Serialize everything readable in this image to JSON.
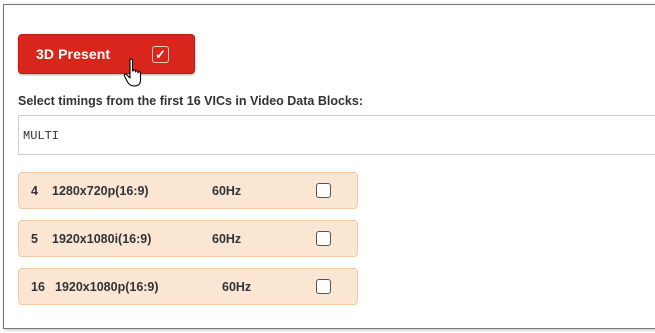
{
  "panel": {
    "present_button": {
      "label": "3D Present",
      "checked": true,
      "check_glyph": "✓",
      "color": "#d9261c"
    },
    "instruction": "Select timings from the first 16 VICs in Video Data Blocks:",
    "multi_field": {
      "value": "MULTI"
    },
    "vics": [
      {
        "vic": "4",
        "resolution": "1280x720p(16:9)",
        "rate": "60Hz",
        "checked": false
      },
      {
        "vic": "5",
        "resolution": "1920x1080i(16:9)",
        "rate": "60Hz",
        "checked": false
      },
      {
        "vic": "16",
        "resolution": "1920x1080p(16:9)",
        "rate": "60Hz",
        "checked": false
      }
    ],
    "row_color": "#fbe6d4",
    "cursor_icon": "hand-pointer-icon"
  }
}
